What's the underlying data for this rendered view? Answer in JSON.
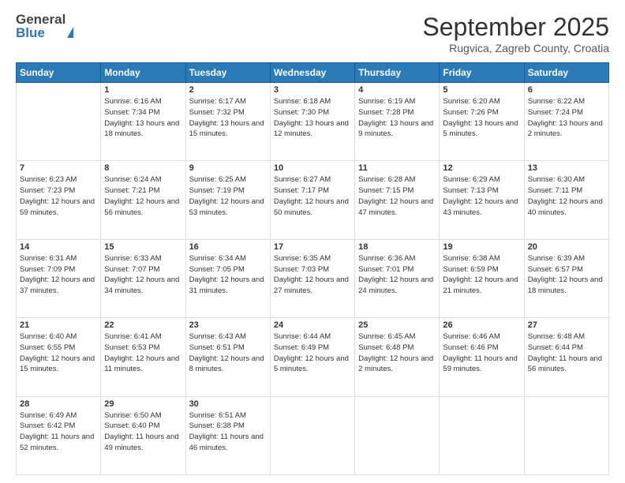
{
  "header": {
    "logo_general": "General",
    "logo_blue": "Blue",
    "month_title": "September 2025",
    "location": "Rugvica, Zagreb County, Croatia"
  },
  "days_of_week": [
    "Sunday",
    "Monday",
    "Tuesday",
    "Wednesday",
    "Thursday",
    "Friday",
    "Saturday"
  ],
  "weeks": [
    [
      {
        "day": "",
        "sunrise": "",
        "sunset": "",
        "daylight": ""
      },
      {
        "day": "1",
        "sunrise": "Sunrise: 6:16 AM",
        "sunset": "Sunset: 7:34 PM",
        "daylight": "Daylight: 13 hours and 18 minutes."
      },
      {
        "day": "2",
        "sunrise": "Sunrise: 6:17 AM",
        "sunset": "Sunset: 7:32 PM",
        "daylight": "Daylight: 13 hours and 15 minutes."
      },
      {
        "day": "3",
        "sunrise": "Sunrise: 6:18 AM",
        "sunset": "Sunset: 7:30 PM",
        "daylight": "Daylight: 13 hours and 12 minutes."
      },
      {
        "day": "4",
        "sunrise": "Sunrise: 6:19 AM",
        "sunset": "Sunset: 7:28 PM",
        "daylight": "Daylight: 13 hours and 9 minutes."
      },
      {
        "day": "5",
        "sunrise": "Sunrise: 6:20 AM",
        "sunset": "Sunset: 7:26 PM",
        "daylight": "Daylight: 13 hours and 5 minutes."
      },
      {
        "day": "6",
        "sunrise": "Sunrise: 6:22 AM",
        "sunset": "Sunset: 7:24 PM",
        "daylight": "Daylight: 13 hours and 2 minutes."
      }
    ],
    [
      {
        "day": "7",
        "sunrise": "Sunrise: 6:23 AM",
        "sunset": "Sunset: 7:23 PM",
        "daylight": "Daylight: 12 hours and 59 minutes."
      },
      {
        "day": "8",
        "sunrise": "Sunrise: 6:24 AM",
        "sunset": "Sunset: 7:21 PM",
        "daylight": "Daylight: 12 hours and 56 minutes."
      },
      {
        "day": "9",
        "sunrise": "Sunrise: 6:25 AM",
        "sunset": "Sunset: 7:19 PM",
        "daylight": "Daylight: 12 hours and 53 minutes."
      },
      {
        "day": "10",
        "sunrise": "Sunrise: 6:27 AM",
        "sunset": "Sunset: 7:17 PM",
        "daylight": "Daylight: 12 hours and 50 minutes."
      },
      {
        "day": "11",
        "sunrise": "Sunrise: 6:28 AM",
        "sunset": "Sunset: 7:15 PM",
        "daylight": "Daylight: 12 hours and 47 minutes."
      },
      {
        "day": "12",
        "sunrise": "Sunrise: 6:29 AM",
        "sunset": "Sunset: 7:13 PM",
        "daylight": "Daylight: 12 hours and 43 minutes."
      },
      {
        "day": "13",
        "sunrise": "Sunrise: 6:30 AM",
        "sunset": "Sunset: 7:11 PM",
        "daylight": "Daylight: 12 hours and 40 minutes."
      }
    ],
    [
      {
        "day": "14",
        "sunrise": "Sunrise: 6:31 AM",
        "sunset": "Sunset: 7:09 PM",
        "daylight": "Daylight: 12 hours and 37 minutes."
      },
      {
        "day": "15",
        "sunrise": "Sunrise: 6:33 AM",
        "sunset": "Sunset: 7:07 PM",
        "daylight": "Daylight: 12 hours and 34 minutes."
      },
      {
        "day": "16",
        "sunrise": "Sunrise: 6:34 AM",
        "sunset": "Sunset: 7:05 PM",
        "daylight": "Daylight: 12 hours and 31 minutes."
      },
      {
        "day": "17",
        "sunrise": "Sunrise: 6:35 AM",
        "sunset": "Sunset: 7:03 PM",
        "daylight": "Daylight: 12 hours and 27 minutes."
      },
      {
        "day": "18",
        "sunrise": "Sunrise: 6:36 AM",
        "sunset": "Sunset: 7:01 PM",
        "daylight": "Daylight: 12 hours and 24 minutes."
      },
      {
        "day": "19",
        "sunrise": "Sunrise: 6:38 AM",
        "sunset": "Sunset: 6:59 PM",
        "daylight": "Daylight: 12 hours and 21 minutes."
      },
      {
        "day": "20",
        "sunrise": "Sunrise: 6:39 AM",
        "sunset": "Sunset: 6:57 PM",
        "daylight": "Daylight: 12 hours and 18 minutes."
      }
    ],
    [
      {
        "day": "21",
        "sunrise": "Sunrise: 6:40 AM",
        "sunset": "Sunset: 6:55 PM",
        "daylight": "Daylight: 12 hours and 15 minutes."
      },
      {
        "day": "22",
        "sunrise": "Sunrise: 6:41 AM",
        "sunset": "Sunset: 6:53 PM",
        "daylight": "Daylight: 12 hours and 11 minutes."
      },
      {
        "day": "23",
        "sunrise": "Sunrise: 6:43 AM",
        "sunset": "Sunset: 6:51 PM",
        "daylight": "Daylight: 12 hours and 8 minutes."
      },
      {
        "day": "24",
        "sunrise": "Sunrise: 6:44 AM",
        "sunset": "Sunset: 6:49 PM",
        "daylight": "Daylight: 12 hours and 5 minutes."
      },
      {
        "day": "25",
        "sunrise": "Sunrise: 6:45 AM",
        "sunset": "Sunset: 6:48 PM",
        "daylight": "Daylight: 12 hours and 2 minutes."
      },
      {
        "day": "26",
        "sunrise": "Sunrise: 6:46 AM",
        "sunset": "Sunset: 6:46 PM",
        "daylight": "Daylight: 11 hours and 59 minutes."
      },
      {
        "day": "27",
        "sunrise": "Sunrise: 6:48 AM",
        "sunset": "Sunset: 6:44 PM",
        "daylight": "Daylight: 11 hours and 56 minutes."
      }
    ],
    [
      {
        "day": "28",
        "sunrise": "Sunrise: 6:49 AM",
        "sunset": "Sunset: 6:42 PM",
        "daylight": "Daylight: 11 hours and 52 minutes."
      },
      {
        "day": "29",
        "sunrise": "Sunrise: 6:50 AM",
        "sunset": "Sunset: 6:40 PM",
        "daylight": "Daylight: 11 hours and 49 minutes."
      },
      {
        "day": "30",
        "sunrise": "Sunrise: 6:51 AM",
        "sunset": "Sunset: 6:38 PM",
        "daylight": "Daylight: 11 hours and 46 minutes."
      },
      {
        "day": "",
        "sunrise": "",
        "sunset": "",
        "daylight": ""
      },
      {
        "day": "",
        "sunrise": "",
        "sunset": "",
        "daylight": ""
      },
      {
        "day": "",
        "sunrise": "",
        "sunset": "",
        "daylight": ""
      },
      {
        "day": "",
        "sunrise": "",
        "sunset": "",
        "daylight": ""
      }
    ]
  ]
}
